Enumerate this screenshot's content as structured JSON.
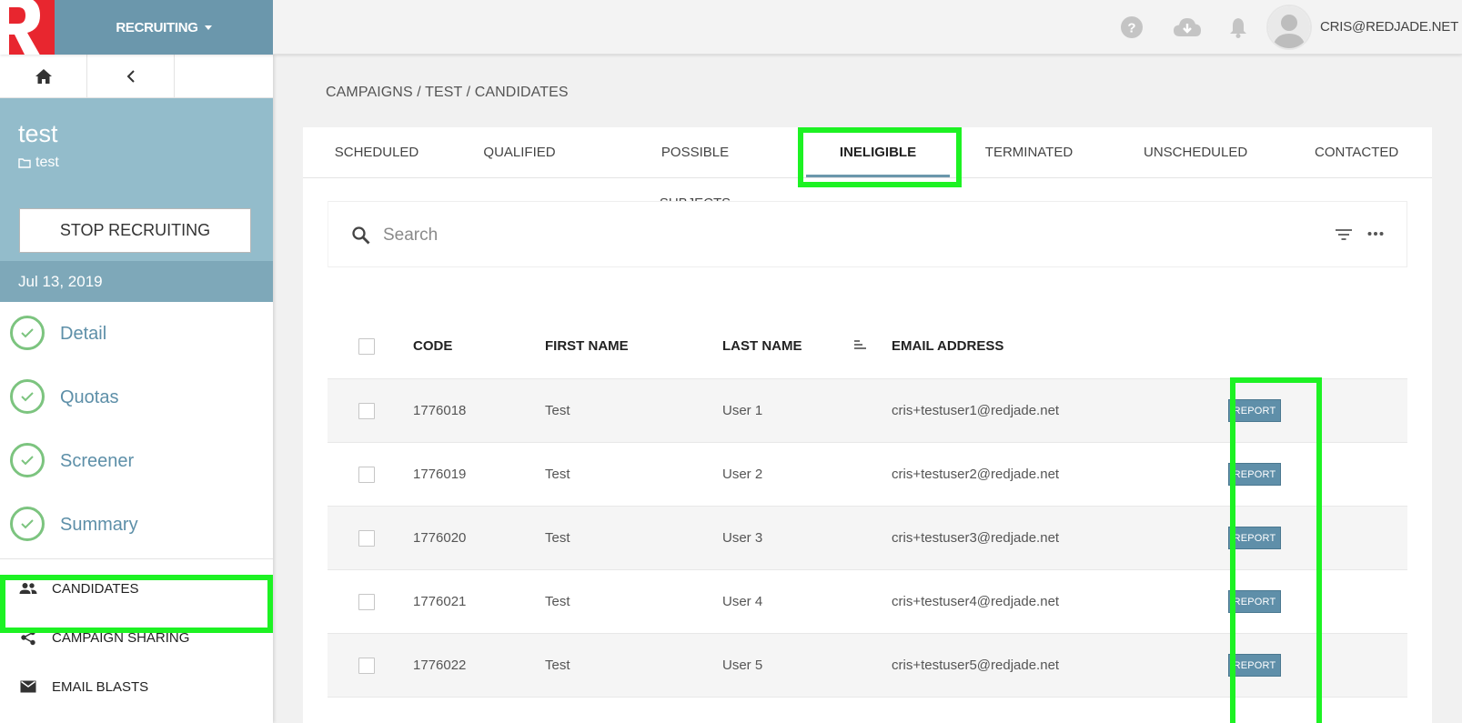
{
  "header": {
    "app_menu_label": "RECRUITING",
    "user_email": "CRIS@REDJADE.NET",
    "icons": [
      "help-icon",
      "cloud-download-icon",
      "bell-icon",
      "avatar"
    ]
  },
  "sidebar": {
    "campaign_title": "test",
    "folder_name": "test",
    "stop_button_label": "STOP RECRUITING",
    "date": "Jul 13, 2019",
    "steps": [
      "Detail",
      "Quotas",
      "Screener",
      "Summary"
    ],
    "links": {
      "candidates": "CANDIDATES",
      "sharing": "CAMPAIGN SHARING",
      "email_blasts": "EMAIL BLASTS"
    }
  },
  "breadcrumb": "CAMPAIGNS / TEST / CANDIDATES",
  "tabs": [
    "SCHEDULED",
    "QUALIFIED",
    "POSSIBLE SUBJECTS",
    "INELIGIBLE",
    "TERMINATED",
    "UNSCHEDULED",
    "CONTACTED"
  ],
  "active_tab": "INELIGIBLE",
  "search": {
    "placeholder": "Search"
  },
  "table": {
    "headers": {
      "code": "CODE",
      "first": "FIRST NAME",
      "last": "LAST NAME",
      "email": "EMAIL ADDRESS"
    },
    "report_label": "REPORT",
    "rows": [
      {
        "code": "1776018",
        "first": "Test",
        "last": "User 1",
        "email": "cris+testuser1@redjade.net"
      },
      {
        "code": "1776019",
        "first": "Test",
        "last": "User 2",
        "email": "cris+testuser2@redjade.net"
      },
      {
        "code": "1776020",
        "first": "Test",
        "last": "User 3",
        "email": "cris+testuser3@redjade.net"
      },
      {
        "code": "1776021",
        "first": "Test",
        "last": "User 4",
        "email": "cris+testuser4@redjade.net"
      },
      {
        "code": "1776022",
        "first": "Test",
        "last": "User 5",
        "email": "cris+testuser5@redjade.net"
      }
    ]
  },
  "colors": {
    "brand_red": "#e8262f",
    "accent_blue": "#6b97ac",
    "sidebar_header": "#93bccb",
    "step_check": "#7cc47f",
    "highlight": "#1df223"
  }
}
